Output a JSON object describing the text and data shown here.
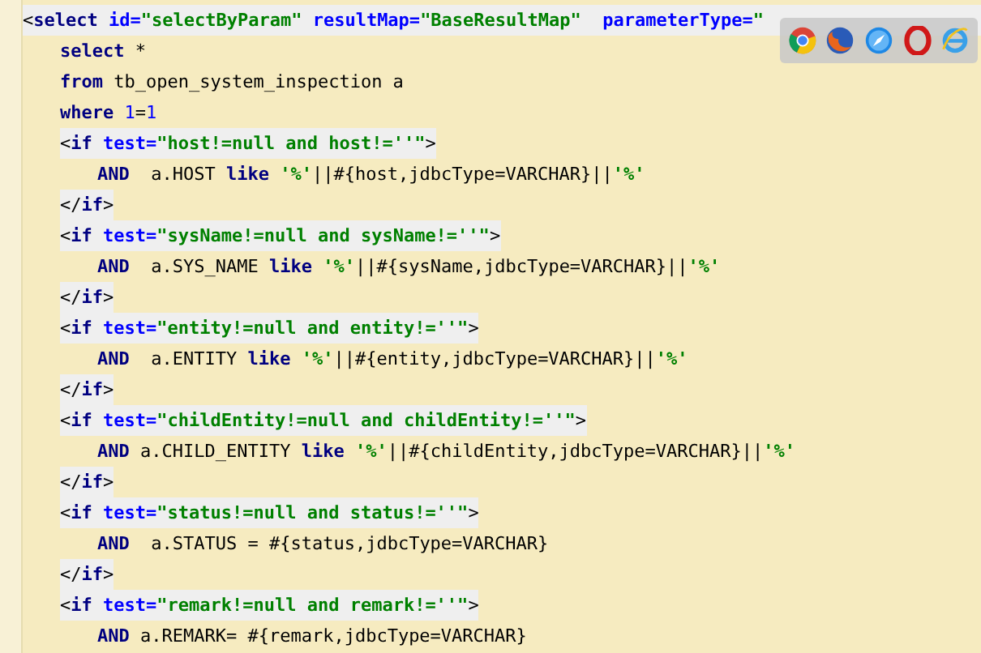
{
  "editor": {
    "lines": [
      {
        "highlight": true,
        "tokens": [
          {
            "kind": "text",
            "text": "<"
          },
          {
            "kind": "kw",
            "text": "select "
          },
          {
            "kind": "attr",
            "text": "id="
          },
          {
            "kind": "str",
            "text": "\"selectByParam\" "
          },
          {
            "kind": "attr",
            "text": "resultMap="
          },
          {
            "kind": "str",
            "text": "\"BaseResultMap\"  "
          },
          {
            "kind": "attr",
            "text": "parameterType="
          },
          {
            "kind": "str",
            "text": "\""
          }
        ],
        "children": [
          {
            "highlight": false,
            "tokens": [
              {
                "kind": "kw",
                "text": "select "
              },
              {
                "kind": "text",
                "text": "*"
              }
            ]
          },
          {
            "highlight": false,
            "tokens": [
              {
                "kind": "kw",
                "text": "from "
              },
              {
                "kind": "text",
                "text": "tb_open_system_inspection a"
              }
            ]
          },
          {
            "highlight": false,
            "tokens": [
              {
                "kind": "kw",
                "text": "where "
              },
              {
                "kind": "num",
                "text": "1"
              },
              {
                "kind": "text",
                "text": "="
              },
              {
                "kind": "num",
                "text": "1"
              }
            ]
          },
          {
            "highlight": true,
            "tokens": [
              {
                "kind": "text",
                "text": "<"
              },
              {
                "kind": "kw",
                "text": "if "
              },
              {
                "kind": "attr",
                "text": "test="
              },
              {
                "kind": "str",
                "text": "\"host!=null and host!=''\""
              },
              {
                "kind": "text",
                "text": ">"
              }
            ],
            "children": [
              {
                "highlight": false,
                "tokens": [
                  {
                    "kind": "kw",
                    "text": "AND  "
                  },
                  {
                    "kind": "text",
                    "text": "a.HOST "
                  },
                  {
                    "kind": "kw",
                    "text": "like "
                  },
                  {
                    "kind": "str",
                    "text": "'%'"
                  },
                  {
                    "kind": "text",
                    "text": "||#{host,jdbcType=VARCHAR}||"
                  },
                  {
                    "kind": "str",
                    "text": "'%'"
                  }
                ]
              }
            ]
          },
          {
            "highlight": true,
            "tokens": [
              {
                "kind": "text",
                "text": "</"
              },
              {
                "kind": "kw",
                "text": "if"
              },
              {
                "kind": "text",
                "text": ">"
              }
            ]
          },
          {
            "highlight": true,
            "tokens": [
              {
                "kind": "text",
                "text": "<"
              },
              {
                "kind": "kw",
                "text": "if "
              },
              {
                "kind": "attr",
                "text": "test="
              },
              {
                "kind": "str",
                "text": "\"sysName!=null and sysName!=''\""
              },
              {
                "kind": "text",
                "text": ">"
              }
            ],
            "children": [
              {
                "highlight": false,
                "tokens": [
                  {
                    "kind": "kw",
                    "text": "AND  "
                  },
                  {
                    "kind": "text",
                    "text": "a.SYS_NAME "
                  },
                  {
                    "kind": "kw",
                    "text": "like "
                  },
                  {
                    "kind": "str",
                    "text": "'%'"
                  },
                  {
                    "kind": "text",
                    "text": "||#{sysName,jdbcType=VARCHAR}||"
                  },
                  {
                    "kind": "str",
                    "text": "'%'"
                  }
                ]
              }
            ]
          },
          {
            "highlight": true,
            "tokens": [
              {
                "kind": "text",
                "text": "</"
              },
              {
                "kind": "kw",
                "text": "if"
              },
              {
                "kind": "text",
                "text": ">"
              }
            ]
          },
          {
            "highlight": true,
            "tokens": [
              {
                "kind": "text",
                "text": "<"
              },
              {
                "kind": "kw",
                "text": "if "
              },
              {
                "kind": "attr",
                "text": "test="
              },
              {
                "kind": "str",
                "text": "\"entity!=null and entity!=''\""
              },
              {
                "kind": "text",
                "text": ">"
              }
            ],
            "children": [
              {
                "highlight": false,
                "tokens": [
                  {
                    "kind": "kw",
                    "text": "AND  "
                  },
                  {
                    "kind": "text",
                    "text": "a.ENTITY "
                  },
                  {
                    "kind": "kw",
                    "text": "like "
                  },
                  {
                    "kind": "str",
                    "text": "'%'"
                  },
                  {
                    "kind": "text",
                    "text": "||#{entity,jdbcType=VARCHAR}||"
                  },
                  {
                    "kind": "str",
                    "text": "'%'"
                  }
                ]
              }
            ]
          },
          {
            "highlight": true,
            "tokens": [
              {
                "kind": "text",
                "text": "</"
              },
              {
                "kind": "kw",
                "text": "if"
              },
              {
                "kind": "text",
                "text": ">"
              }
            ]
          },
          {
            "highlight": true,
            "tokens": [
              {
                "kind": "text",
                "text": "<"
              },
              {
                "kind": "kw",
                "text": "if "
              },
              {
                "kind": "attr",
                "text": "test="
              },
              {
                "kind": "str",
                "text": "\"childEntity!=null and childEntity!=''\""
              },
              {
                "kind": "text",
                "text": ">"
              }
            ],
            "children": [
              {
                "highlight": false,
                "tokens": [
                  {
                    "kind": "kw",
                    "text": "AND "
                  },
                  {
                    "kind": "text",
                    "text": "a.CHILD_ENTITY "
                  },
                  {
                    "kind": "kw",
                    "text": "like "
                  },
                  {
                    "kind": "str",
                    "text": "'%'"
                  },
                  {
                    "kind": "text",
                    "text": "||#{childEntity,jdbcType=VARCHAR}||"
                  },
                  {
                    "kind": "str",
                    "text": "'%'"
                  }
                ]
              }
            ]
          },
          {
            "highlight": true,
            "tokens": [
              {
                "kind": "text",
                "text": "</"
              },
              {
                "kind": "kw",
                "text": "if"
              },
              {
                "kind": "text",
                "text": ">"
              }
            ]
          },
          {
            "highlight": true,
            "tokens": [
              {
                "kind": "text",
                "text": "<"
              },
              {
                "kind": "kw",
                "text": "if "
              },
              {
                "kind": "attr",
                "text": "test="
              },
              {
                "kind": "str",
                "text": "\"status!=null and status!=''\""
              },
              {
                "kind": "text",
                "text": ">"
              }
            ],
            "children": [
              {
                "highlight": false,
                "tokens": [
                  {
                    "kind": "kw",
                    "text": "AND  "
                  },
                  {
                    "kind": "text",
                    "text": "a.STATUS = #{status,jdbcType=VARCHAR}"
                  }
                ]
              }
            ]
          },
          {
            "highlight": true,
            "tokens": [
              {
                "kind": "text",
                "text": "</"
              },
              {
                "kind": "kw",
                "text": "if"
              },
              {
                "kind": "text",
                "text": ">"
              }
            ]
          },
          {
            "highlight": true,
            "tokens": [
              {
                "kind": "text",
                "text": "<"
              },
              {
                "kind": "kw",
                "text": "if "
              },
              {
                "kind": "attr",
                "text": "test="
              },
              {
                "kind": "str",
                "text": "\"remark!=null and remark!=''\""
              },
              {
                "kind": "text",
                "text": ">"
              }
            ],
            "children": [
              {
                "highlight": false,
                "tokens": [
                  {
                    "kind": "kw",
                    "text": "AND "
                  },
                  {
                    "kind": "text",
                    "text": "a.REMARK= #{remark,jdbcType=VARCHAR}"
                  }
                ]
              }
            ]
          }
        ]
      }
    ]
  }
}
